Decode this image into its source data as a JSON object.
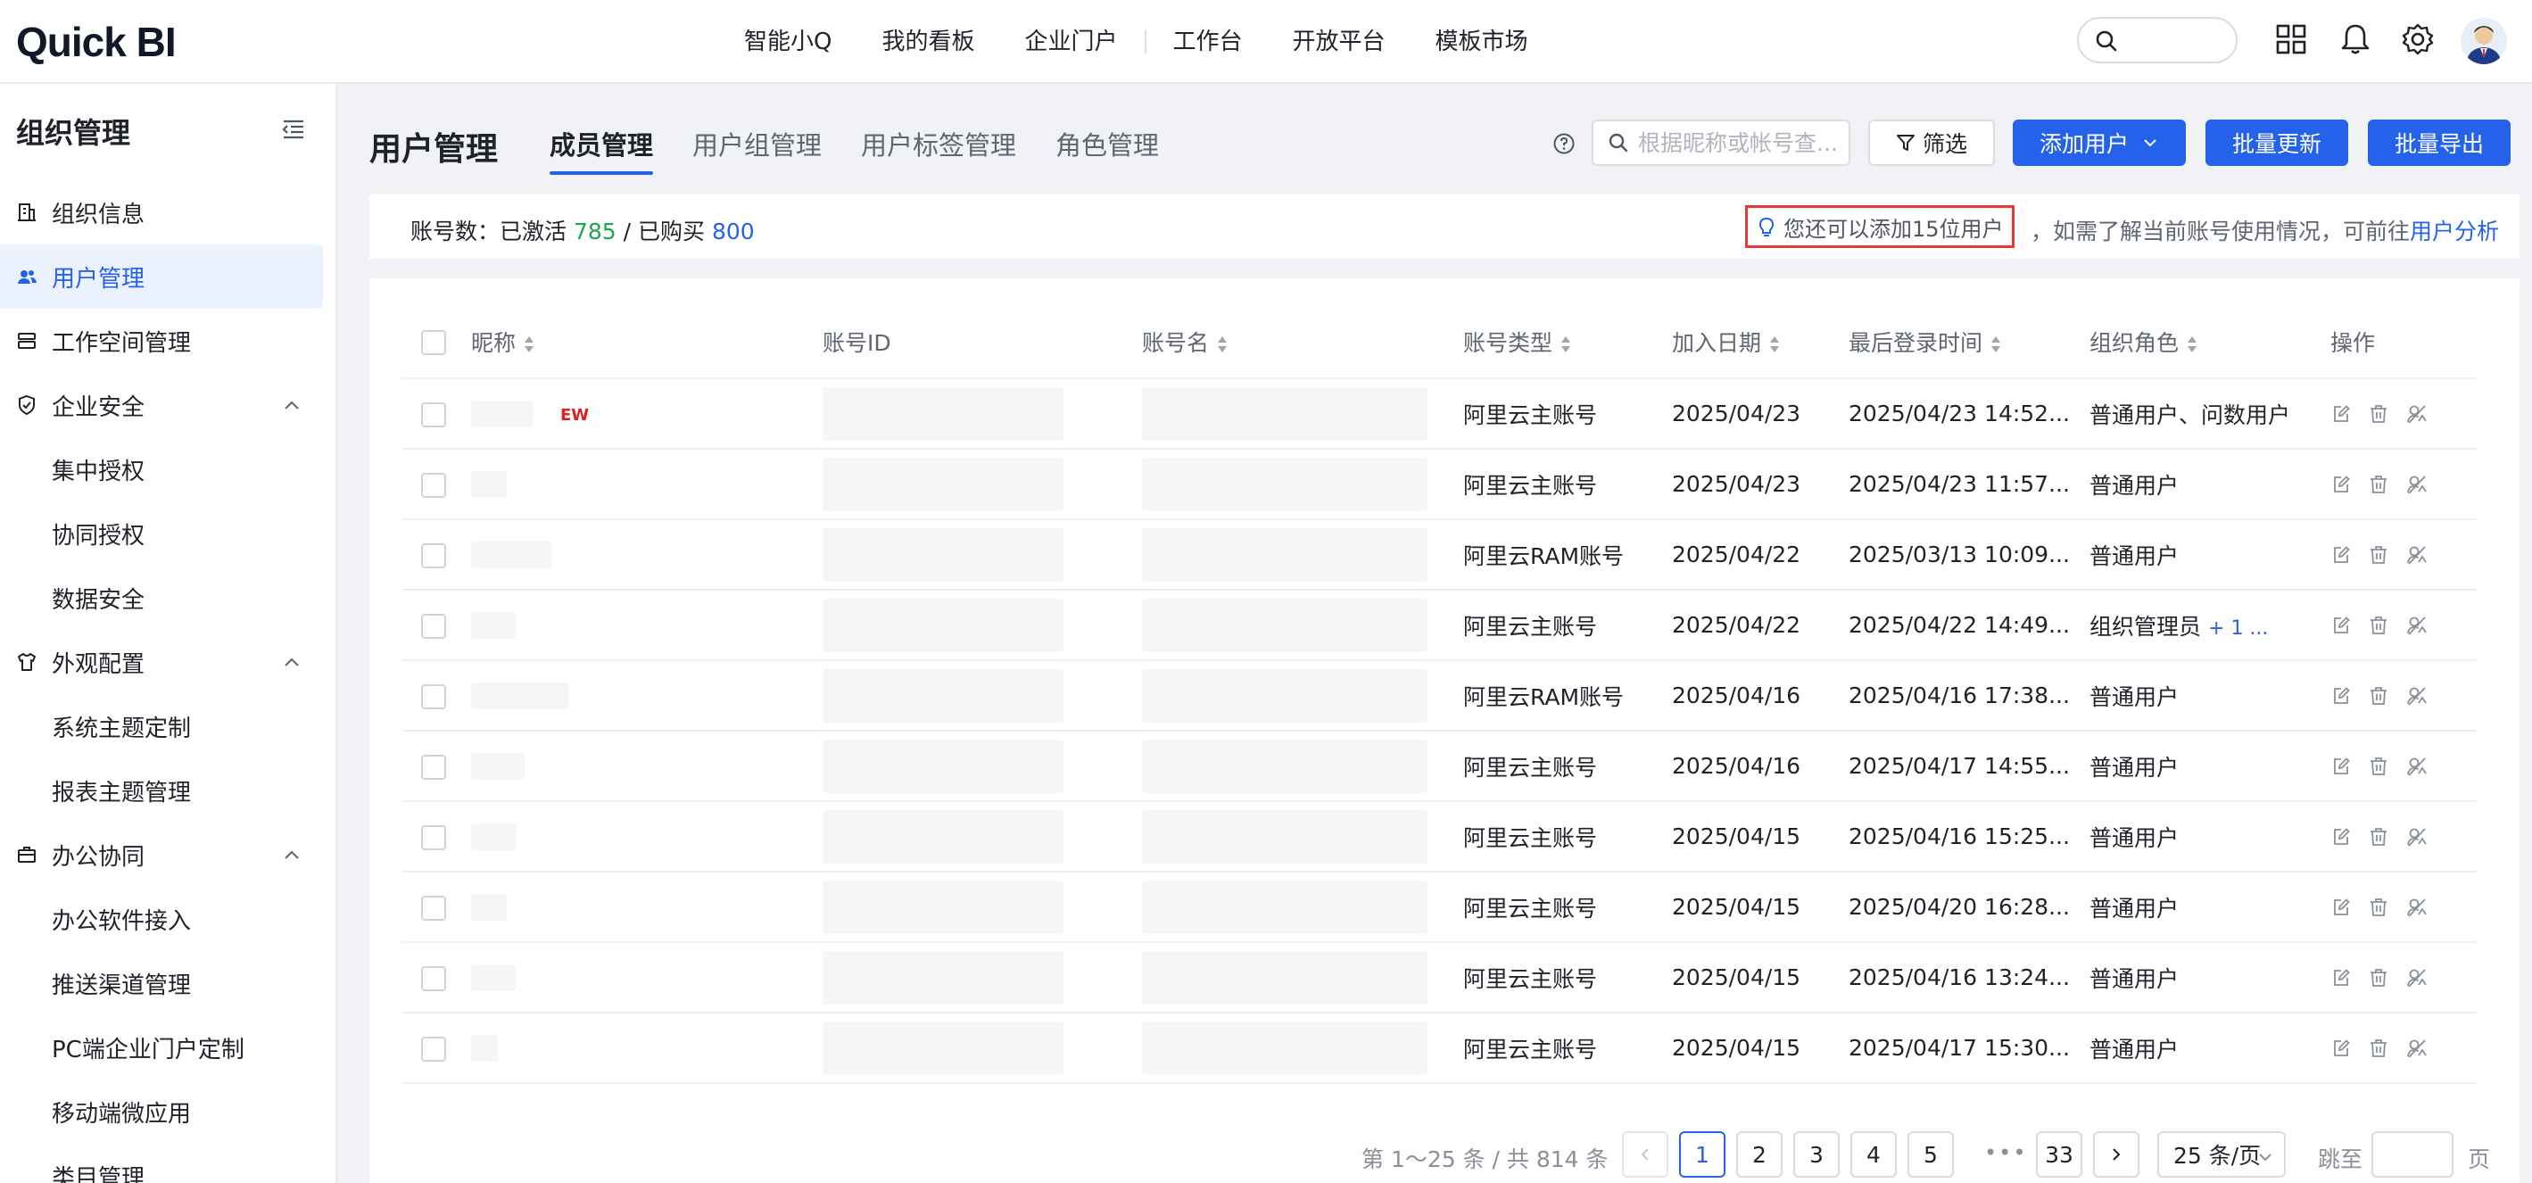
{
  "app": {
    "logo": "Quick BI"
  },
  "topnav": {
    "items": [
      "智能小Q",
      "我的看板",
      "企业门户",
      "工作台",
      "开放平台",
      "模板市场"
    ]
  },
  "sidebar": {
    "title": "组织管理",
    "items": [
      {
        "label": "组织信息",
        "icon": "building-icon"
      },
      {
        "label": "用户管理",
        "icon": "users-icon",
        "active": true
      },
      {
        "label": "工作空间管理",
        "icon": "workspace-icon"
      },
      {
        "label": "企业安全",
        "icon": "shield-icon",
        "expanded": true
      },
      {
        "label": "集中授权",
        "sub": true
      },
      {
        "label": "协同授权",
        "sub": true
      },
      {
        "label": "数据安全",
        "sub": true
      },
      {
        "label": "外观配置",
        "icon": "shirt-icon",
        "expanded": true
      },
      {
        "label": "系统主题定制",
        "sub": true
      },
      {
        "label": "报表主题管理",
        "sub": true
      },
      {
        "label": "办公协同",
        "icon": "briefcase-icon",
        "expanded": true
      },
      {
        "label": "办公软件接入",
        "sub": true
      },
      {
        "label": "推送渠道管理",
        "sub": true
      },
      {
        "label": "PC端企业门户定制",
        "sub": true
      },
      {
        "label": "移动端微应用",
        "sub": true
      },
      {
        "label": "类目管理",
        "sub": true
      }
    ]
  },
  "main": {
    "title": "用户管理",
    "tabs": [
      {
        "label": "成员管理",
        "active": true
      },
      {
        "label": "用户组管理"
      },
      {
        "label": "用户标签管理"
      },
      {
        "label": "角色管理"
      }
    ],
    "search_placeholder": "根据昵称或帐号查...",
    "filter_label": "筛选",
    "add_user_label": "添加用户",
    "batch_update_label": "批量更新",
    "batch_export_label": "批量导出"
  },
  "info": {
    "accounts_label": "账号数：已激活",
    "activated": "785",
    "separator": " / ",
    "purchased_label": "已购买",
    "purchased": "800",
    "hint": "您还可以添加15位用户",
    "right_text": "，如需了解当前账号使用情况，可前往",
    "link": "用户分析"
  },
  "table": {
    "headers": [
      "昵称",
      "账号ID",
      "账号名",
      "账号类型",
      "加入日期",
      "最后登录时间",
      "组织角色",
      "操作"
    ],
    "rows": [
      {
        "type": "阿里云主账号",
        "date": "2025/04/23",
        "last": "2025/04/23 14:52...",
        "role": "普通用户、问数用户",
        "more": "",
        "tag": "EW"
      },
      {
        "type": "阿里云主账号",
        "date": "2025/04/23",
        "last": "2025/04/23 11:57...",
        "role": "普通用户",
        "more": "",
        "tag": ""
      },
      {
        "type": "阿里云RAM账号",
        "date": "2025/04/22",
        "last": "2025/03/13 10:09...",
        "role": "普通用户",
        "more": "",
        "tag": ""
      },
      {
        "type": "阿里云主账号",
        "date": "2025/04/22",
        "last": "2025/04/22 14:49...",
        "role": "组织管理员",
        "more": "+ 1 ...",
        "tag": ""
      },
      {
        "type": "阿里云RAM账号",
        "date": "2025/04/16",
        "last": "2025/04/16 17:38...",
        "role": "普通用户",
        "more": "",
        "tag": ""
      },
      {
        "type": "阿里云主账号",
        "date": "2025/04/16",
        "last": "2025/04/17 14:55...",
        "role": "普通用户",
        "more": "",
        "tag": ""
      },
      {
        "type": "阿里云主账号",
        "date": "2025/04/15",
        "last": "2025/04/16 15:25...",
        "role": "普通用户",
        "more": "",
        "tag": ""
      },
      {
        "type": "阿里云主账号",
        "date": "2025/04/15",
        "last": "2025/04/20 16:28...",
        "role": "普通用户",
        "more": "",
        "tag": ""
      },
      {
        "type": "阿里云主账号",
        "date": "2025/04/15",
        "last": "2025/04/16 13:24...",
        "role": "普通用户",
        "more": "",
        "tag": ""
      },
      {
        "type": "阿里云主账号",
        "date": "2025/04/15",
        "last": "2025/04/17 15:30...",
        "role": "普通用户",
        "more": "",
        "tag": ""
      }
    ]
  },
  "pagination": {
    "total_text": "第 1～25 条 / 共 814 条",
    "pages": [
      "1",
      "2",
      "3",
      "4",
      "5"
    ],
    "current": "1",
    "ellipsis": "•••",
    "last_page": "33",
    "page_size": "25 条/页",
    "jump_label": "跳至",
    "page_label": "页"
  },
  "colors": {
    "primary": "#2462ea",
    "activated_green": "#1fa64a",
    "hint_border": "#e53935"
  }
}
